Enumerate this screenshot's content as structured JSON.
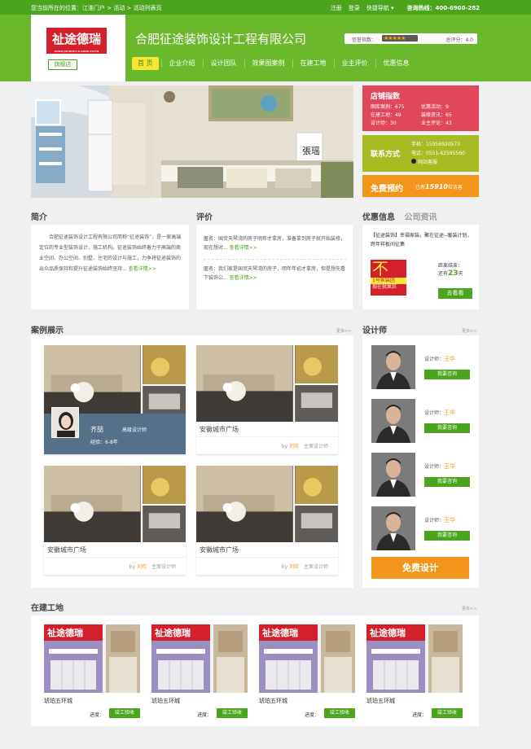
{
  "topbar": {
    "location": "您当前所在的位置：江淮门户 > 活动 > 活动列表页",
    "links": [
      "注册",
      "登录",
      "快捷导航"
    ],
    "hotline": "咨询热线：400-6900-282"
  },
  "header": {
    "logo_text": "祉途德瑞",
    "logo_sub": "GOOD JOURNEY & GOOD FAITH",
    "logo_tag": "旗舰店",
    "company": "合肥征途装饰设计工程有限公司",
    "credit_label": "信誉指数：",
    "credit_stars": "★★★★★",
    "score": "总评分：4.0"
  },
  "nav": [
    "首 页",
    "企业介绍",
    "设计团队",
    "效果图案例",
    "在建工地",
    "业主评价",
    "优惠信息"
  ],
  "store_index": {
    "title": "店铺指数",
    "rows": [
      [
        "图库案例：675",
        "优惠活动：9"
      ],
      [
        "在建工地：49",
        "装修资讯：65"
      ],
      [
        "设计师：30",
        "业主评论：43"
      ]
    ]
  },
  "contact": {
    "title": "联系方式",
    "phone": "手机：15956920573",
    "tel": "电话：0551-62595560",
    "qq": "网站客服"
  },
  "reserve": {
    "title": "免费预约",
    "text_pre": "已有",
    "count": "15910",
    "text_post": "位访客"
  },
  "banner": {
    "seal_text": "張瑶"
  },
  "intro": {
    "title": "简介",
    "body": "合肥征途装饰设计工程有限公司简称“征途装饰”，是一家高端定位的专业型装饰设计、施工机构。征途装饰始终着力于高端的商业空间、办公空间、别墅、住宅的设计与施工，力争将征途装饰的出众品质保持和提升征途装饰始终坚持...",
    "link": "查看详情>>"
  },
  "reviews": {
    "title": "评价",
    "items": [
      {
        "text": "匿名：国贸天琴湾的房子明年才拿房，准备拿到房子就开始装修，现在想对...",
        "link": "查看详情>>"
      },
      {
        "text": "匿名：我们家是国贸天琴湾的房子，明年年初才拿房，但是想先看下装饰公...",
        "link": "查看详情>>"
      }
    ]
  },
  "promo": {
    "tabs": [
      "优惠信息",
      "公司资讯"
    ],
    "headline": "【征途装饰】幸福家装，聚在征途--暖装计划，跨年样板间征集",
    "poster_big": "不",
    "poster_lines": [
      "1号家装团",
      "现在就疯狂"
    ],
    "end_label": "距离结束：",
    "days_pre": "还有",
    "days": "23",
    "days_post": "天",
    "button": "去看看"
  },
  "cases": {
    "title": "案例展示",
    "more": "更多>>",
    "items": [
      {
        "name": "齐喆",
        "role": "高级设计师",
        "exp": "经验：6-8年",
        "overlay": true
      },
      {
        "name": "安徽城市广场",
        "by": "by",
        "author": "刘欢",
        "role": "主案设计师",
        "overlay": false
      },
      {
        "name": "安徽城市广场",
        "by": "by",
        "author": "刘欢",
        "role": "主案设计师",
        "overlay": false
      },
      {
        "name": "安徽城市广场",
        "by": "by",
        "author": "刘欢",
        "role": "主案设计师",
        "overlay": false
      }
    ]
  },
  "designers": {
    "title": "设计师",
    "more": "更多>>",
    "label": "设计师：",
    "items": [
      {
        "name": "王华",
        "button": "我要咨询"
      },
      {
        "name": "王华",
        "button": "我要咨询"
      },
      {
        "name": "王华",
        "button": "我要咨询"
      },
      {
        "name": "王华",
        "button": "我要咨询"
      }
    ],
    "free_design": "免费设计"
  },
  "sites": {
    "title": "在建工地",
    "more": "更多>>",
    "items": [
      {
        "name": "琥珀五环城",
        "progress_label": "进度：",
        "progress": "竣工验收"
      },
      {
        "name": "琥珀五环城",
        "progress_label": "进度：",
        "progress": "竣工验收"
      },
      {
        "name": "琥珀五环城",
        "progress_label": "进度：",
        "progress": "竣工验收"
      },
      {
        "name": "琥珀五环城",
        "progress_label": "进度：",
        "progress": "竣工验收"
      }
    ]
  },
  "colors": {
    "brand_green": "#4aa51c",
    "header_green": "#6ab82c",
    "red": "#d4202a",
    "pink": "#e0475a",
    "olive": "#a7bb22",
    "orange": "#f4951b"
  }
}
